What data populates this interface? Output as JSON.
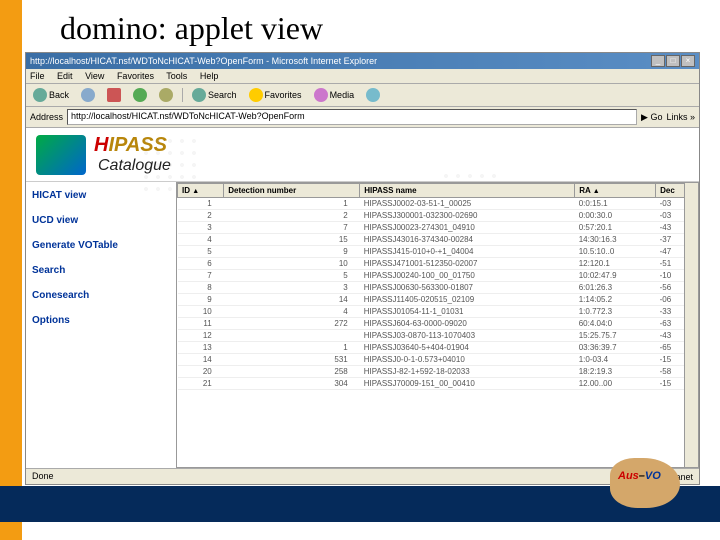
{
  "slide": {
    "title": "domino: applet view"
  },
  "browser": {
    "title": "http://localhost/HICAT.nsf/WDToNcHICAT-Web?OpenForm - Microsoft Internet Explorer",
    "menu": [
      "File",
      "Edit",
      "View",
      "Favorites",
      "Tools",
      "Help"
    ],
    "toolbar": {
      "back": "Back",
      "search": "Search",
      "favorites": "Favorites",
      "media": "Media"
    },
    "address_label": "Address",
    "address": "http://localhost/HICAT.nsf/WDToNcHICAT-Web?OpenForm",
    "go": "Go",
    "links": "Links »"
  },
  "header": {
    "brand_h": "H",
    "brand_rest": "IPASS",
    "catalogue": "Catalogue"
  },
  "sidebar": {
    "items": [
      {
        "label": "HICAT view"
      },
      {
        "label": "UCD view"
      },
      {
        "label": "Generate VOTable"
      },
      {
        "label": "Search"
      },
      {
        "label": "Conesearch"
      },
      {
        "label": "Options"
      }
    ]
  },
  "table": {
    "columns": [
      "ID",
      "Detection number",
      "HIPASS name",
      "RA",
      "Dec"
    ],
    "rows": [
      [
        "1",
        "1",
        "HIPASSJ0002-03-51-1_00025",
        "0:0:15.1",
        "-03"
      ],
      [
        "2",
        "2",
        "HIPASSJ300001-032300-02690",
        "0:00:30.0",
        "-03"
      ],
      [
        "3",
        "7",
        "HIPASSJ00023-274301_04910",
        "0:57:20.1",
        "-43"
      ],
      [
        "4",
        "15",
        "HIPASSJ43016-374340-00284",
        "14:30:16.3",
        "-37"
      ],
      [
        "5",
        "9",
        "HIPASSJ415-010+0-+1_04004",
        "10.5:10..0",
        "-47"
      ],
      [
        "6",
        "10",
        "HIPASSJ471001-512350-02007",
        "12:120.1",
        "-51"
      ],
      [
        "7",
        "5",
        "HIPASSJ00240-100_00_01750",
        "10:02:47.9",
        "-10"
      ],
      [
        "8",
        "3",
        "HIPASSJ00630-563300-01807",
        "6:01:26.3",
        "-56"
      ],
      [
        "9",
        "14",
        "HIPASSJ11405-020515_02109",
        "1:14:05.2",
        "-06"
      ],
      [
        "10",
        "4",
        "HIPASSJ01054-11-1_01031",
        "1:0.772.3",
        "-33"
      ],
      [
        "11",
        "272",
        "HIPASSJ604-63-0000-09020",
        "60:4.04:0",
        "-63"
      ],
      [
        "12",
        "",
        "HIPASSJ03-0870-113-1070403",
        "15:25.75.7",
        "-43"
      ],
      [
        "13",
        "1",
        "HIPASSJ03640-5+404-01904",
        "03:36:39.7",
        "-65"
      ],
      [
        "14",
        "531",
        "HIPASSJ0-0-1-0.573+04010",
        "1:0-03.4",
        "-15"
      ],
      [
        "20",
        "258",
        "HIPASSJ-82-1+592-18-02033",
        "18:2:19.3",
        "-58"
      ],
      [
        "21",
        "304",
        "HIPASSJ70009-151_00_00410",
        "12.00..00",
        "-15"
      ]
    ]
  },
  "status": {
    "left": "Done",
    "right": "Local intranet"
  },
  "logo": {
    "aus": "Aus",
    "dash": "–",
    "vo": "VO"
  }
}
